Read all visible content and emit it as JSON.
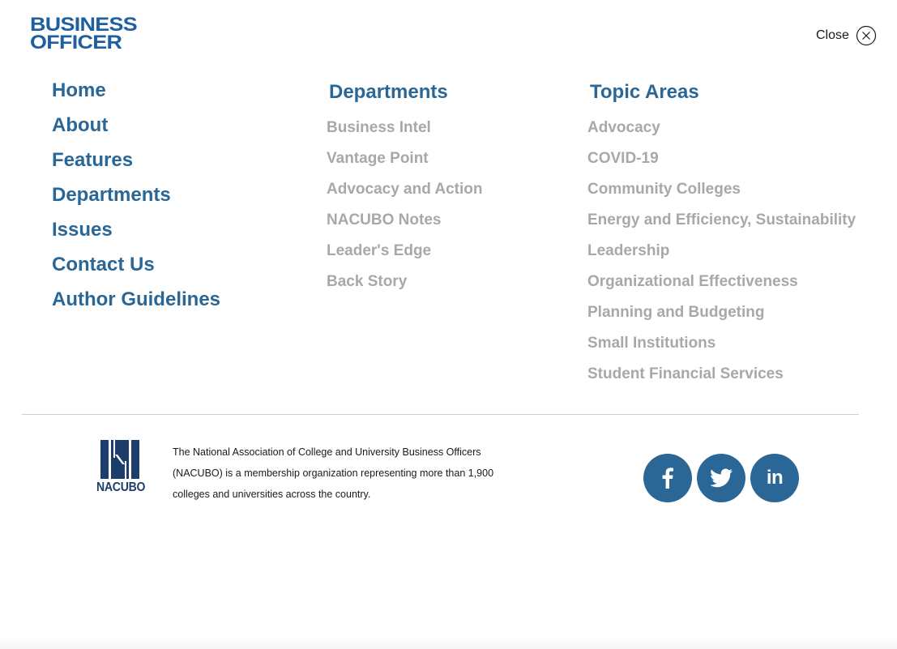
{
  "logo": {
    "line1": "BUSINESS",
    "line2": "OFFICER",
    "color": "#1d5fa0"
  },
  "close": {
    "label": "Close",
    "icon": "close-circle-icon"
  },
  "main_nav": [
    "Home",
    "About",
    "Features",
    "Departments",
    "Issues",
    "Contact Us",
    "Author Guidelines"
  ],
  "departments": {
    "title": "Departments",
    "items": [
      "Business Intel",
      "Vantage Point",
      "Advocacy and Action",
      "NACUBO Notes",
      "Leader's Edge",
      "Back Story"
    ]
  },
  "topics": {
    "title": "Topic Areas",
    "items": [
      "Advocacy",
      "COVID-19",
      "Community Colleges",
      "Energy and Efficiency, Sustainability",
      "Leadership",
      "Organizational Effectiveness",
      "Planning and Budgeting",
      "Small Institutions",
      "Student Financial Services"
    ]
  },
  "footer": {
    "org_logo_text": "NACUBO",
    "description": "The National Association of College and University Business Officers (NACUBO) is a membership organization representing more than 1,900 colleges and universities across the country.",
    "social": [
      {
        "name": "facebook",
        "icon": "facebook-icon"
      },
      {
        "name": "twitter",
        "icon": "twitter-icon"
      },
      {
        "name": "linkedin",
        "icon": "linkedin-icon",
        "glyph": "in"
      }
    ]
  },
  "colors": {
    "primary_heading": "#2a6796",
    "secondary_link": "#a8a8a8",
    "logo_blue": "#1d5fa0",
    "nacubo_navy": "#1d3d6b"
  }
}
